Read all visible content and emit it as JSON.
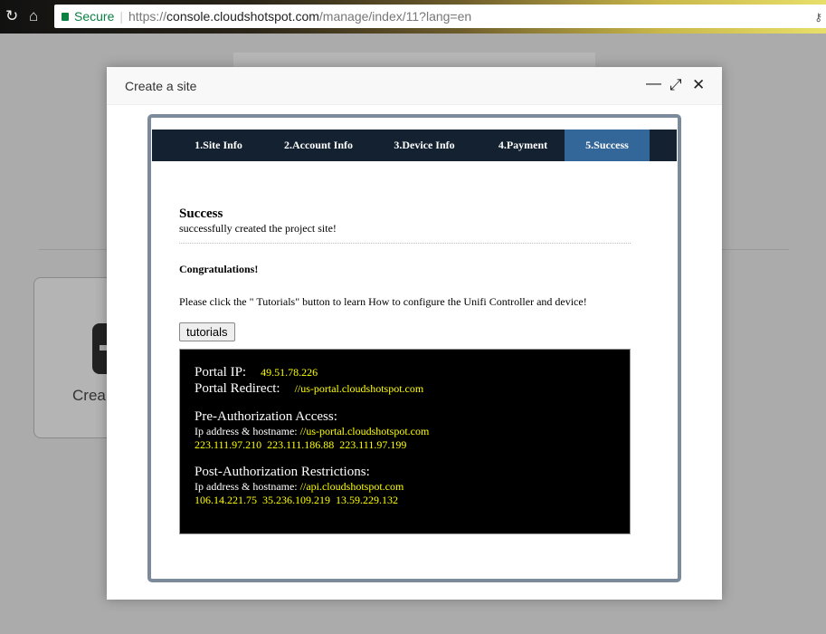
{
  "browser": {
    "secure_label": "Secure",
    "url_scheme": "https://",
    "url_host": "console.cloudshotspot.com",
    "url_path": "/manage/index/11?lang=en"
  },
  "background": {
    "card_text": "Crea"
  },
  "modal": {
    "title": "Create a site",
    "steps": [
      {
        "label": "1.Site Info"
      },
      {
        "label": "2.Account Info"
      },
      {
        "label": "3.Device Info"
      },
      {
        "label": "4.Payment"
      },
      {
        "label": "5.Success",
        "active": true
      }
    ],
    "heading": "Success",
    "subheading": "successfully created the project site!",
    "congrats": "Congratulations!",
    "instruction": "Please click the \" Tutorials\" button to learn How to configure the Unifi Controller and device!",
    "tutorials_button": "tutorials",
    "info": {
      "portal_ip_label": "Portal IP:",
      "portal_ip": "49.51.78.226",
      "portal_redirect_label": "Portal Redirect:",
      "portal_redirect": "//us-portal.cloudshotspot.com",
      "pre_title": "Pre-Authorization Access:",
      "pre_host_label": "Ip address & hostname:",
      "pre_host": "//us-portal.cloudshotspot.com",
      "pre_ips": "223.111.97.210  223.111.186.88  223.111.97.199",
      "post_title": "Post-Authorization Restrictions:",
      "post_host_label": "Ip address & hostname:",
      "post_host": "//api.cloudshotspot.com",
      "post_ips": "106.14.221.75  35.236.109.219  13.59.229.132"
    }
  }
}
